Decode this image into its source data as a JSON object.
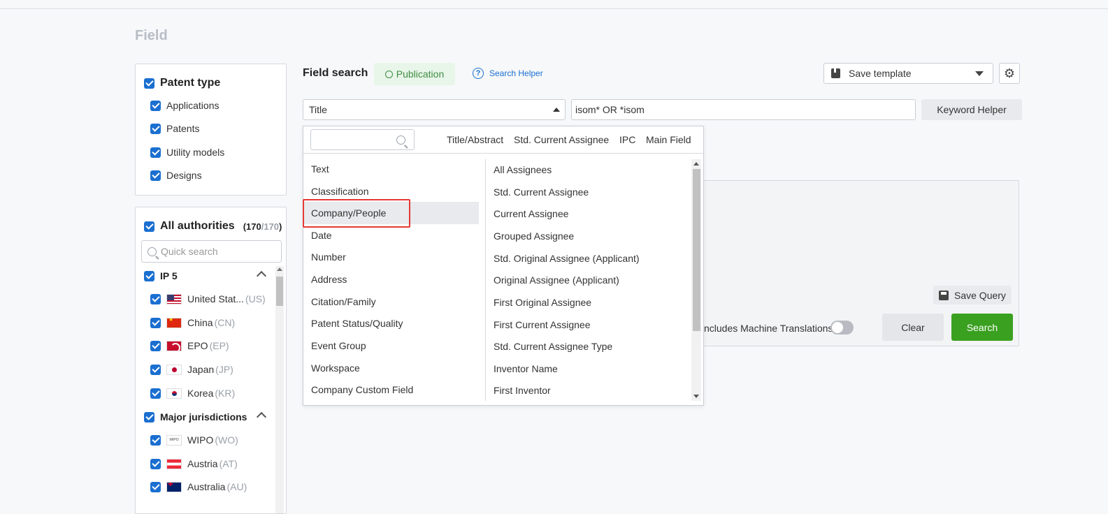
{
  "page": {
    "title": "Field"
  },
  "patent_type": {
    "header": "Patent type",
    "options": [
      "Applications",
      "Patents",
      "Utility models",
      "Designs"
    ]
  },
  "authorities": {
    "header": "All authorities",
    "selected": "170",
    "total": "/170",
    "search_placeholder": "Quick search",
    "groups": [
      {
        "name": "IP 5",
        "items": [
          {
            "name": "United Stat...",
            "code": "(US)",
            "flag": "us-flag-icon"
          },
          {
            "name": "China",
            "code": "(CN)",
            "flag": "cn-flag-icon"
          },
          {
            "name": "EPO",
            "code": "(EP)",
            "flag": "ep-flag-icon"
          },
          {
            "name": "Japan",
            "code": "(JP)",
            "flag": "jp-flag-icon"
          },
          {
            "name": "Korea",
            "code": "(KR)",
            "flag": "kr-flag-icon"
          }
        ]
      },
      {
        "name": "Major jurisdictions",
        "items": [
          {
            "name": "WIPO",
            "code": "(WO)",
            "flag": "wo-flag-icon",
            "flag_text": "WIPO"
          },
          {
            "name": "Austria",
            "code": "(AT)",
            "flag": "at-flag-icon"
          },
          {
            "name": "Australia",
            "code": "(AU)",
            "flag": "au-flag-icon"
          }
        ]
      }
    ]
  },
  "field_search": {
    "title": "Field search",
    "publication_badge": "Publication",
    "search_helper": "Search Helper",
    "help_glyph": "?",
    "save_template": "Save template",
    "gear_glyph": "⚙",
    "field_select_value": "Title",
    "keyword_value": "isom* OR *isom",
    "keyword_helper": "Keyword Helper",
    "save_query": "Save Query",
    "machine_translations_label": "ncludes Machine Translations",
    "clear": "Clear",
    "search": "Search"
  },
  "dropdown": {
    "quick_fields": [
      "Title/Abstract",
      "Std. Current Assignee",
      "IPC",
      "Main Field"
    ],
    "categories": [
      "Text",
      "Classification",
      "Company/People",
      "Date",
      "Number",
      "Address",
      "Citation/Family",
      "Patent Status/Quality",
      "Event Group",
      "Workspace",
      "Company Custom Field"
    ],
    "active_category": "Company/People",
    "fields": [
      "All Assignees",
      "Std. Current Assignee",
      "Current Assignee",
      "Grouped Assignee",
      "Std. Original Assignee (Applicant)",
      "Original Assignee (Applicant)",
      "First Original Assignee",
      "First Current Assignee",
      "Std. Current Assignee Type",
      "Inventor Name",
      "First Inventor"
    ]
  },
  "colors": {
    "accent": "#1a6fd0",
    "search_green": "#3aa020",
    "highlight_red": "#e53935",
    "publication_green": "#3e8e41"
  }
}
